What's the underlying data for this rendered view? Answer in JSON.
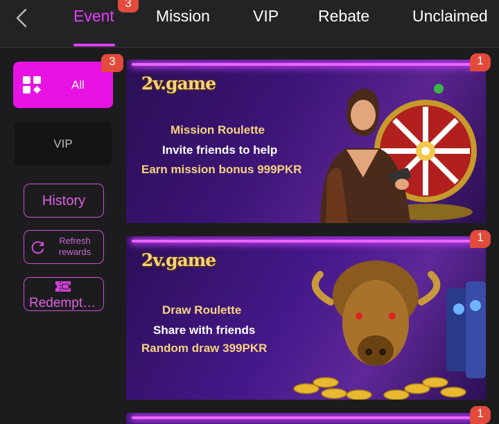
{
  "nav": {
    "tabs": [
      {
        "label": "Event",
        "active": true,
        "badge": "3"
      },
      {
        "label": "Mission"
      },
      {
        "label": "VIP"
      },
      {
        "label": "Rebate"
      },
      {
        "label": "Unclaimed"
      }
    ],
    "back_icon": "chevron-left-icon"
  },
  "sidebar": {
    "all": {
      "label": "All",
      "badge": "3",
      "icon": "grid-icon"
    },
    "vip": {
      "label": "VIP"
    },
    "history": {
      "label": "History"
    },
    "refresh": {
      "label": "Refresh rewards",
      "icon": "refresh-icon"
    },
    "redemption": {
      "label": "Redempt…",
      "icon": "ticket-icon"
    }
  },
  "cards": [
    {
      "badge": "1",
      "logo": "2v.game",
      "lines": [
        "Mission Roulette",
        "Invite friends to help",
        "Earn mission bonus 999PKR"
      ],
      "art": "woman-with-roulette-wheel"
    },
    {
      "badge": "1",
      "logo": "2v.game",
      "lines": [
        "Draw Roulette",
        "Share with friends",
        "Random draw 399PKR"
      ],
      "art": "golden-bison-with-coins"
    },
    {
      "badge": "1"
    }
  ],
  "colors": {
    "accent": "#e040fb",
    "sidebar_active": "#e812e4",
    "badge": "#e24a3b",
    "promo_gold": "#f6d47f"
  }
}
